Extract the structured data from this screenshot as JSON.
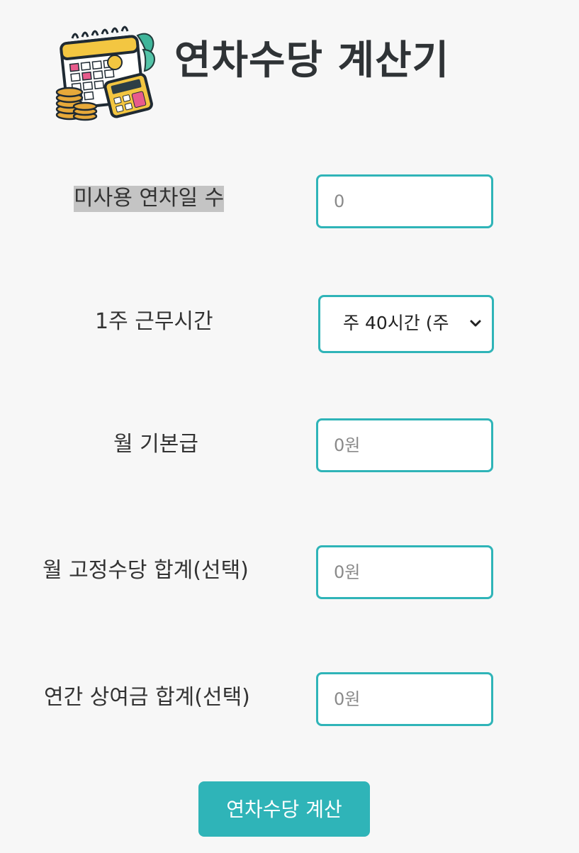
{
  "header": {
    "title": "연차수당 계산기",
    "logo_icon": "calendar-calculator-coins-icon"
  },
  "form": {
    "unused_leave": {
      "label": "미사용 연차일 수",
      "placeholder": "0"
    },
    "weekly_hours": {
      "label": "1주 근무시간",
      "selected": "주 40시간 (주"
    },
    "base_salary": {
      "label": "월 기본급",
      "placeholder": "0원"
    },
    "fixed_allowance": {
      "label": "월 고정수당 합계(선택)",
      "placeholder": "0원"
    },
    "annual_bonus": {
      "label": "연간 상여금 합계(선택)",
      "placeholder": "0원"
    }
  },
  "actions": {
    "calculate_label": "연차수당 계산"
  },
  "colors": {
    "accent": "#2fb4b8",
    "background": "#f7f7f7",
    "highlight": "#c4c4c4"
  }
}
